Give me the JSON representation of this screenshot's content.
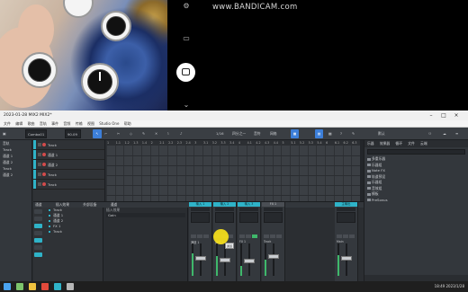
{
  "watermark": "www.BANDICAM.com",
  "window": {
    "title": "2023-01-28 MIX2 MIX2*",
    "menu": [
      "文件",
      "编辑",
      "歌曲",
      "音轨",
      "事件",
      "音频",
      "传输",
      "视图",
      "Studio One",
      "帮助"
    ]
  },
  "toolbar": {
    "song_name": "Combo01",
    "tempo": "90.09",
    "snap": "1/16",
    "quantize": "四分之一",
    "groove": "音符",
    "bar": "网格",
    "zoom": "默认"
  },
  "inspector": {
    "title": "音轨",
    "items": [
      "Track",
      "通道 1",
      "通道 2",
      "Track",
      "通道 2"
    ]
  },
  "tracks": [
    {
      "name": "Track"
    },
    {
      "name": "通道 1"
    },
    {
      "name": "通道 2"
    },
    {
      "name": "Track"
    },
    {
      "name": "Track"
    }
  ],
  "ruler_ticks": [
    "1",
    "1.1",
    "1.2",
    "1.3",
    "1.4",
    "2",
    "2.1",
    "2.2",
    "2.3",
    "2.4",
    "3",
    "3.1",
    "3.2",
    "3.3",
    "3.4",
    "4",
    "4.1",
    "4.2",
    "4.3",
    "4.4",
    "5",
    "5.1",
    "5.2",
    "5.3",
    "5.4",
    "6",
    "6.1",
    "6.2",
    "6.3"
  ],
  "browser": {
    "tabs": [
      "乐器",
      "效果器",
      "循环",
      "文件",
      "云端"
    ],
    "items": [
      "多重乐器",
      "乐器组",
      "Note FX",
      "轨道预设",
      "乐器组",
      "音效组",
      "模板",
      "PreSonus"
    ]
  },
  "mixer": {
    "header": [
      "通道",
      "插入效果",
      "外部设备",
      "通道"
    ],
    "list": [
      "Track",
      "通道 1",
      "通道 2",
      "FX 1",
      "Track"
    ],
    "insert_header": "插入效果",
    "insert_slot": "Gain",
    "strips": [
      {
        "name": "输入 1",
        "label": "通道 1",
        "fader": 0.55,
        "meter": 0.7
      },
      {
        "name": "输入 2",
        "label": "通道 2",
        "fader": 0.5,
        "meter": 0.6
      },
      {
        "name": "输入 3",
        "label": "FX 1",
        "fader": 0.45,
        "meter": 0.3
      },
      {
        "name": "FX 1",
        "label": "Track",
        "fader": 0.6,
        "meter": 0.5
      },
      {
        "name": "主输出",
        "label": "Main",
        "fader": 0.55,
        "meter": 0.65
      }
    ]
  },
  "cursor_tip": "通道",
  "tray": {
    "time": "18:49",
    "date": "2023/1/28"
  }
}
